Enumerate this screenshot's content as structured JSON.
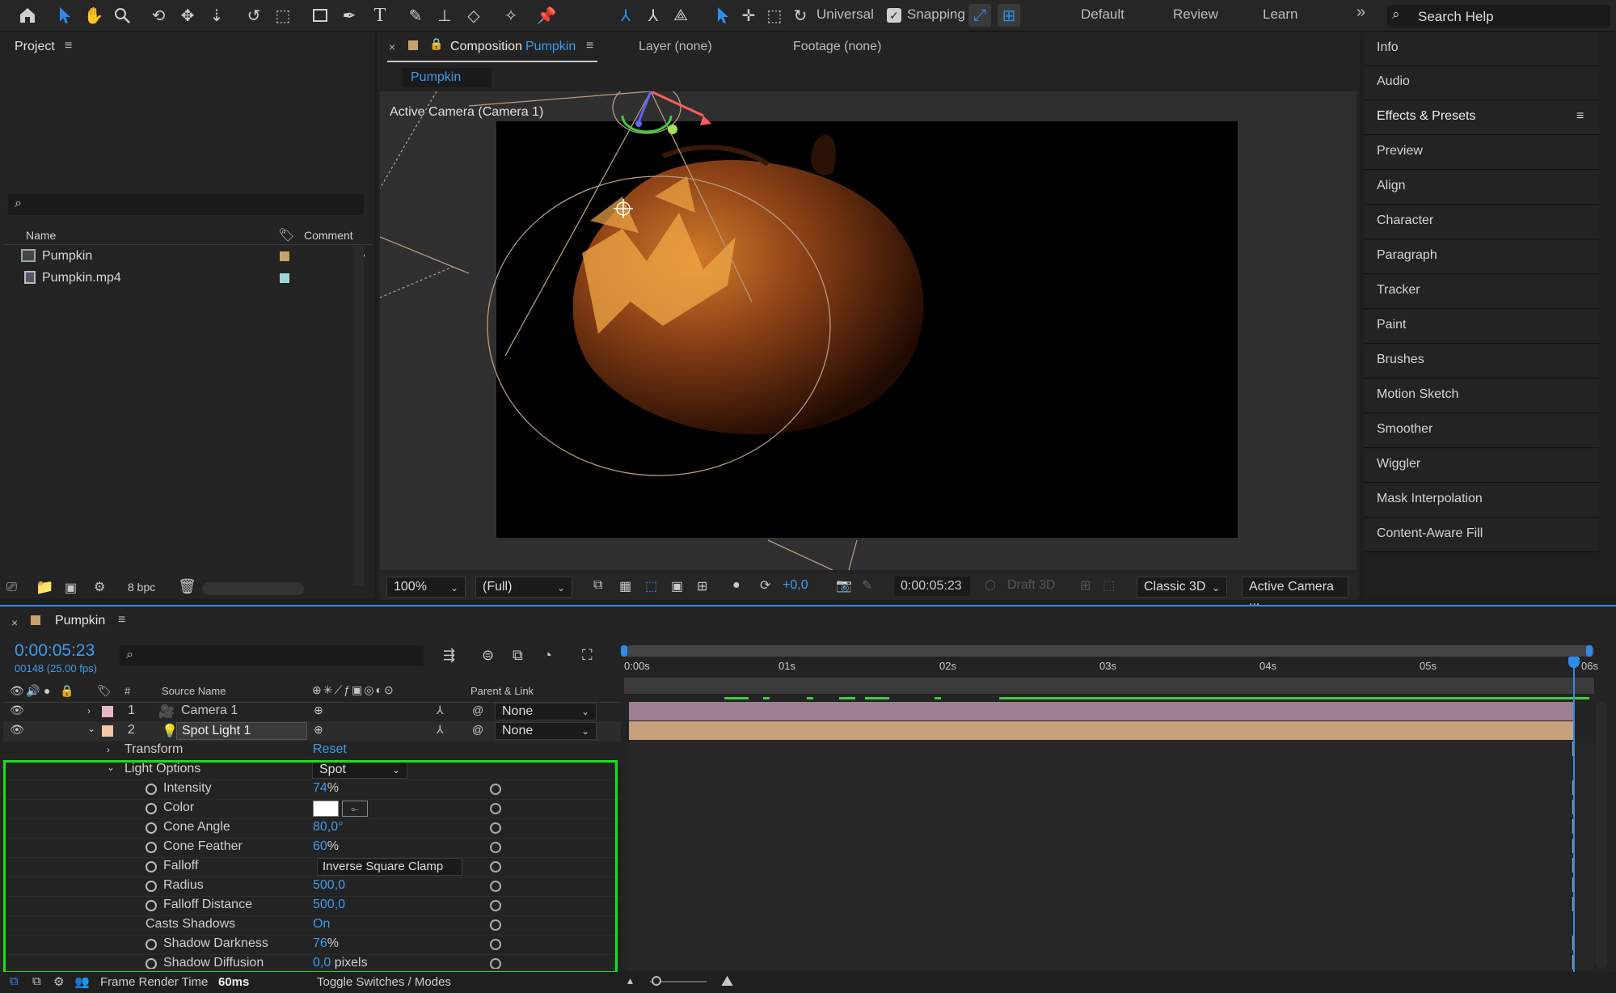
{
  "toolbar": {
    "mode_label": "Universal",
    "snapping_label": "Snapping",
    "workspaces": [
      "Default",
      "Review",
      "Learn"
    ],
    "more_label": "»",
    "search_placeholder": "Search Help"
  },
  "project": {
    "title": "Project",
    "columns": {
      "name": "Name",
      "comment": "Comment"
    },
    "items": [
      {
        "name": "Pumpkin",
        "color": "#c9a26b"
      },
      {
        "name": "Pumpkin.mp4",
        "color": "#9fd6d6"
      }
    ],
    "bpc": "8 bpc"
  },
  "composition": {
    "close": "×",
    "label": "Composition",
    "name": "Pumpkin",
    "layer_tab": "Layer (none)",
    "footage_tab": "Footage (none)",
    "sub_tab": "Pumpkin",
    "camera_label": "Active Camera (Camera 1)",
    "zoom": "100%",
    "resolution": "(Full)",
    "exposure": "+0,0",
    "timecode": "0:00:05:23",
    "draft3d": "Draft 3D",
    "renderer": "Classic 3D",
    "view": "Active Camera ..."
  },
  "right_panels": [
    "Info",
    "Audio",
    "Effects & Presets",
    "Preview",
    "Align",
    "Character",
    "Paragraph",
    "Tracker",
    "Paint",
    "Brushes",
    "Motion Sketch",
    "Smoother",
    "Wiggler",
    "Mask Interpolation",
    "Content-Aware Fill"
  ],
  "timeline": {
    "close": "×",
    "comp_name": "Pumpkin",
    "timecode": "0:00:05:23",
    "frame_info": "00148 (25.00 fps)",
    "col_source": "Source Name",
    "col_parent": "Parent & Link",
    "col_num": "#",
    "ruler": [
      "0:00s",
      "01s",
      "02s",
      "03s",
      "04s",
      "05s",
      "06s"
    ],
    "layers": [
      {
        "num": "1",
        "name": "Camera 1",
        "parent": "None",
        "color": "#e7b6c8"
      },
      {
        "num": "2",
        "name": "Spot Light 1",
        "parent": "None",
        "color": "#f3c9a4"
      }
    ],
    "transform": {
      "label": "Transform",
      "action": "Reset"
    },
    "light_options": {
      "label": "Light Options",
      "value": "Spot"
    },
    "properties": [
      {
        "name": "Intensity",
        "value": "74",
        "unit": "%"
      },
      {
        "name": "Color",
        "value": "",
        "unit": ""
      },
      {
        "name": "Cone Angle",
        "value": "80,0°",
        "unit": ""
      },
      {
        "name": "Cone Feather",
        "value": "60",
        "unit": "%"
      },
      {
        "name": "Falloff",
        "value": "Inverse Square Clamp",
        "unit": ""
      },
      {
        "name": "Radius",
        "value": "500,0",
        "unit": ""
      },
      {
        "name": "Falloff Distance",
        "value": "500,0",
        "unit": ""
      },
      {
        "name": "Casts Shadows",
        "value": "On",
        "unit": ""
      },
      {
        "name": "Shadow Darkness",
        "value": "76",
        "unit": "%"
      },
      {
        "name": "Shadow Diffusion",
        "value": "0,0",
        "unit": " pixels"
      }
    ],
    "footer_render_label": "Frame Render Time",
    "footer_render_value": "60ms",
    "footer_toggle": "Toggle Switches / Modes"
  }
}
